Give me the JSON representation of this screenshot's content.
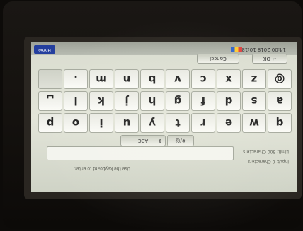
{
  "status_bar": {
    "tab_label": "Home",
    "datetime": "14:00 2018 10:18"
  },
  "input_panel": {
    "hint": "Use the keyboard to enter.",
    "input_count": "Input: 0 Characters",
    "limit": "Limit: 500 Characters",
    "mode_label": "ABC",
    "symbol_label": "#/@"
  },
  "action_bar": {
    "cancel_label": "Cancel",
    "ok_label": "OK"
  },
  "keyboard": {
    "rows": [
      [
        "q",
        "w",
        "e",
        "r",
        "t",
        "y",
        "u",
        "i",
        "o",
        "p"
      ],
      [
        "a",
        "s",
        "d",
        "f",
        "g",
        "h",
        "j",
        "k",
        "l",
        "␣"
      ],
      [
        "@",
        "z",
        "x",
        "c",
        "v",
        "b",
        "n",
        "m",
        ".",
        ""
      ]
    ]
  },
  "colors": {
    "tab_blue": "#243f9e",
    "screen_bg": "#dee0d4"
  }
}
